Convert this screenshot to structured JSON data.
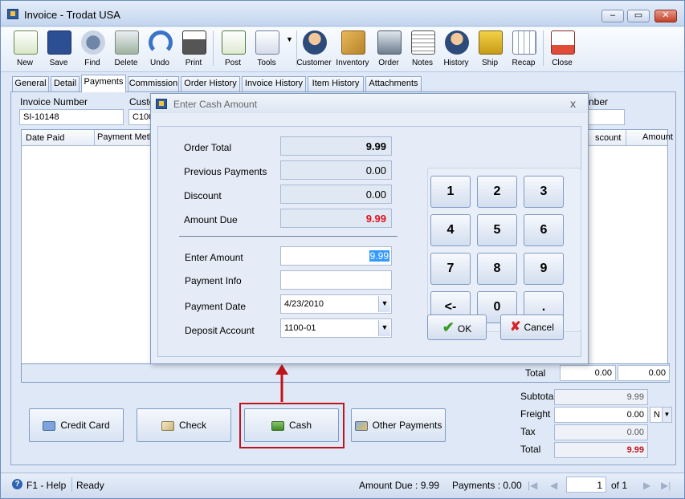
{
  "window": {
    "title": "Invoice - Trodat USA",
    "min": "–",
    "max": "▭",
    "close": "✕"
  },
  "toolbar": [
    "New",
    "Save",
    "Find",
    "Delete",
    "Undo",
    "Print",
    "Post",
    "Tools",
    "Customer",
    "Inventory",
    "Order",
    "Notes",
    "History",
    "Ship",
    "Recap",
    "Close"
  ],
  "tabs": [
    "General",
    "Detail",
    "Payments",
    "Commission",
    "Order History",
    "Invoice History",
    "Item History",
    "Attachments"
  ],
  "header": {
    "invoice_number_label": "Invoice Number",
    "invoice_number": "SI-10148",
    "customer_label": "Custo",
    "customer_value": "C100",
    "number_label": "nber"
  },
  "grid": {
    "date_paid": "Date Paid",
    "payment_method": "Payment Metho",
    "discount": "scount",
    "amount": "Amount",
    "total_label": "Total",
    "total_discount": "0.00",
    "total_amount": "0.00"
  },
  "buttons": {
    "credit_card": "Credit Card",
    "check": "Check",
    "cash": "Cash",
    "other_payments": "Other Payments"
  },
  "summary": {
    "subtotal_label": "Subtotal",
    "subtotal": "9.99",
    "freight_label": "Freight",
    "freight": "0.00",
    "freight_term": "N",
    "tax_label": "Tax",
    "tax": "0.00",
    "total_label": "Total",
    "total": "9.99"
  },
  "status": {
    "help": "F1 - Help",
    "ready": "Ready",
    "amount_due": "Amount Due : 9.99",
    "payments": "Payments : 0.00",
    "page": "1",
    "of": "of  1"
  },
  "dialog": {
    "title": "Enter Cash Amount",
    "close": "x",
    "order_total_label": "Order Total",
    "order_total": "9.99",
    "previous_payments_label": "Previous Payments",
    "previous_payments": "0.00",
    "discount_label": "Discount",
    "discount": "0.00",
    "amount_due_label": "Amount Due",
    "amount_due": "9.99",
    "enter_amount_label": "Enter Amount",
    "enter_amount": "9.99",
    "payment_info_label": "Payment Info",
    "payment_info": "",
    "payment_date_label": "Payment Date",
    "payment_date": "4/23/2010",
    "deposit_account_label": "Deposit Account",
    "deposit_account": "1100-01",
    "ok": "OK",
    "cancel": "Cancel"
  },
  "keypad": [
    "1",
    "2",
    "3",
    "4",
    "5",
    "6",
    "7",
    "8",
    "9",
    "<-",
    "0",
    "."
  ],
  "colors": {
    "accent_red": "#e0101c",
    "highlight_border": "#c0141c"
  }
}
